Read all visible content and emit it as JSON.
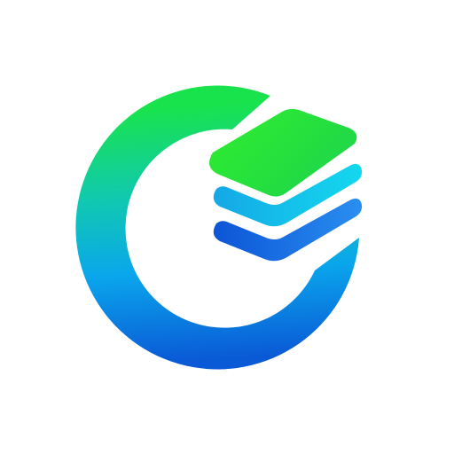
{
  "app": {
    "icon": "stacked-layers-ring-logo",
    "colors": {
      "green": "#22e63a",
      "cyan": "#0fc8e8",
      "blue": "#0a5fdc",
      "ring_top": "#19e34c",
      "ring_left": "#10c9b0",
      "ring_bottom": "#0aa6ec",
      "ring_right": "#0a59d6",
      "background": "#ffffff"
    }
  }
}
